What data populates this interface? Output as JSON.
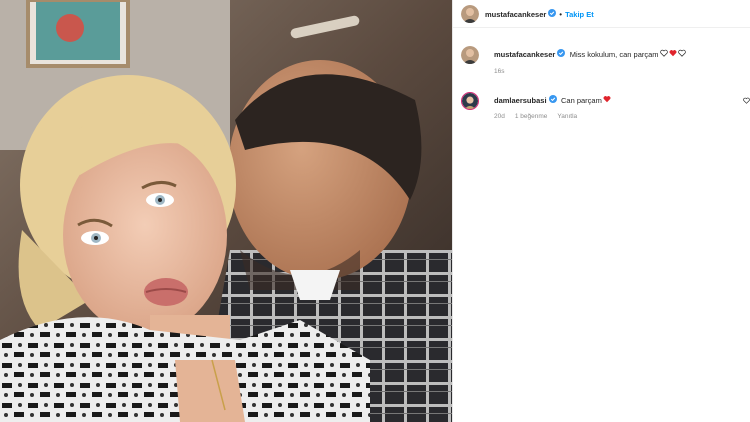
{
  "post": {
    "author": "mustafacankeser",
    "follow_label": "Takip Et",
    "separator": "•"
  },
  "caption": {
    "username": "mustafacankeser",
    "text": "Miss kokulum, can parçam",
    "time": "16s",
    "hearts": [
      "white-heart-icon",
      "red-heart-icon",
      "white-heart-icon"
    ]
  },
  "comments": [
    {
      "username": "damlaersubasi",
      "text": "Can parçam",
      "time": "20d",
      "likes": "1 beğenme",
      "reply": "Yanıtla"
    }
  ],
  "colors": {
    "link": "#0095f6",
    "verified": "#3897f0",
    "heart_red": "#e0242c",
    "text": "#262626",
    "muted": "#8e8e8e"
  }
}
